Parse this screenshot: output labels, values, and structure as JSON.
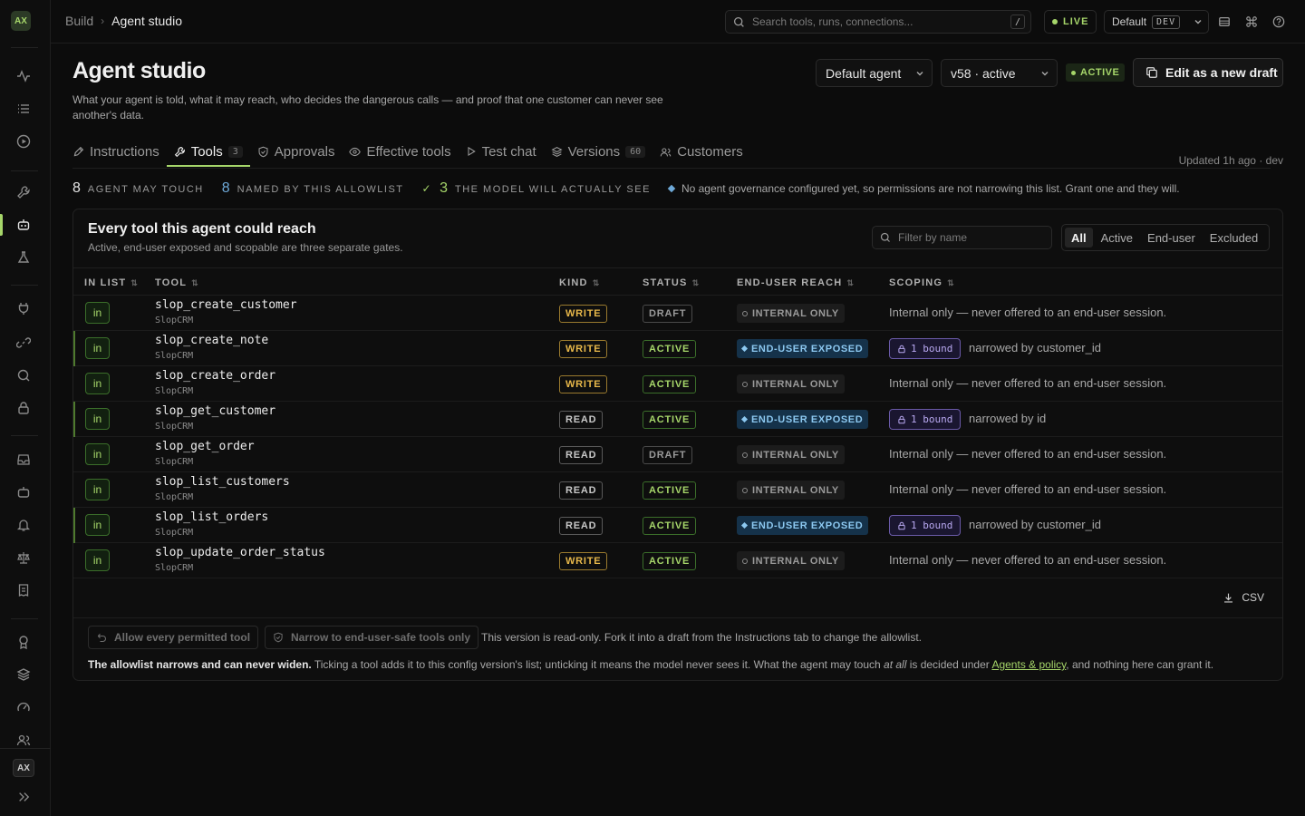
{
  "rail": {
    "logo": "AX",
    "avatar": "AX"
  },
  "topbar": {
    "breadcrumb": [
      "Build",
      "Agent studio"
    ],
    "search_placeholder": "Search tools, runs, connections...",
    "search_kbd": "/",
    "live_label": "LIVE",
    "env_label": "Default",
    "env_badge": "DEV"
  },
  "header": {
    "title": "Agent studio",
    "subtitle": "What your agent is told, what it may reach, who decides the dangerous calls — and proof that one customer can never see another's data.",
    "agent_select": "Default agent",
    "version_select": "v58 · active",
    "active_badge": "ACTIVE",
    "draft_button": "Edit as a new draft"
  },
  "tabs": [
    {
      "label": "Instructions",
      "count": ""
    },
    {
      "label": "Tools",
      "count": "3"
    },
    {
      "label": "Approvals",
      "count": ""
    },
    {
      "label": "Effective tools",
      "count": ""
    },
    {
      "label": "Test chat",
      "count": ""
    },
    {
      "label": "Versions",
      "count": "60"
    },
    {
      "label": "Customers",
      "count": ""
    }
  ],
  "updated": "Updated 1h ago · dev",
  "stats": {
    "may_touch_num": "8",
    "may_touch_label": "AGENT MAY TOUCH",
    "named_num": "8",
    "named_label": "NAMED BY THIS ALLOWLIST",
    "see_num": "3",
    "see_label": "THE MODEL WILL ACTUALLY SEE",
    "note": "No agent governance configured yet, so permissions are not narrowing this list. Grant one and they will."
  },
  "card": {
    "title": "Every tool this agent could reach",
    "subtitle": "Active, end-user exposed and scopable are three separate gates.",
    "filter_placeholder": "Filter by name",
    "segments": [
      "All",
      "Active",
      "End-user",
      "Excluded"
    ],
    "columns": [
      "IN LIST",
      "TOOL",
      "KIND",
      "STATUS",
      "END-USER REACH",
      "SCOPING"
    ],
    "csv_label": "CSV",
    "btn_allow_all": "Allow every permitted tool",
    "btn_narrow": "Narrow to end-user-safe tools only",
    "readonly_note": "This version is read-only. Fork it into a draft from the Instructions tab to change the allowlist.",
    "legal_bold": "The allowlist narrows and can never widen.",
    "legal_text1": " Ticking a tool adds it to this config version's list; unticking it means the model never sees it. What the agent may touch ",
    "legal_italic": "at all",
    "legal_text2": " is decided under ",
    "legal_link": "Agents & policy",
    "legal_text3": ", and nothing here can grant it."
  },
  "rows": [
    {
      "in": "in",
      "tool": "slop_create_customer",
      "system": "SlopCRM",
      "kind": "WRITE",
      "status": "DRAFT",
      "reach": "INTERNAL ONLY",
      "exposed": false,
      "scope": "Internal only — never offered to an end-user session.",
      "bound": "",
      "narrow": ""
    },
    {
      "in": "in",
      "tool": "slop_create_note",
      "system": "SlopCRM",
      "kind": "WRITE",
      "status": "ACTIVE",
      "reach": "END-USER EXPOSED",
      "exposed": true,
      "scope": "",
      "bound": "1 bound",
      "narrow": "narrowed by customer_id"
    },
    {
      "in": "in",
      "tool": "slop_create_order",
      "system": "SlopCRM",
      "kind": "WRITE",
      "status": "ACTIVE",
      "reach": "INTERNAL ONLY",
      "exposed": false,
      "scope": "Internal only — never offered to an end-user session.",
      "bound": "",
      "narrow": ""
    },
    {
      "in": "in",
      "tool": "slop_get_customer",
      "system": "SlopCRM",
      "kind": "READ",
      "status": "ACTIVE",
      "reach": "END-USER EXPOSED",
      "exposed": true,
      "scope": "",
      "bound": "1 bound",
      "narrow": "narrowed by id"
    },
    {
      "in": "in",
      "tool": "slop_get_order",
      "system": "SlopCRM",
      "kind": "READ",
      "status": "DRAFT",
      "reach": "INTERNAL ONLY",
      "exposed": false,
      "scope": "Internal only — never offered to an end-user session.",
      "bound": "",
      "narrow": ""
    },
    {
      "in": "in",
      "tool": "slop_list_customers",
      "system": "SlopCRM",
      "kind": "READ",
      "status": "ACTIVE",
      "reach": "INTERNAL ONLY",
      "exposed": false,
      "scope": "Internal only — never offered to an end-user session.",
      "bound": "",
      "narrow": ""
    },
    {
      "in": "in",
      "tool": "slop_list_orders",
      "system": "SlopCRM",
      "kind": "READ",
      "status": "ACTIVE",
      "reach": "END-USER EXPOSED",
      "exposed": true,
      "scope": "",
      "bound": "1 bound",
      "narrow": "narrowed by customer_id"
    },
    {
      "in": "in",
      "tool": "slop_update_order_status",
      "system": "SlopCRM",
      "kind": "WRITE",
      "status": "ACTIVE",
      "reach": "INTERNAL ONLY",
      "exposed": false,
      "scope": "Internal only — never offered to an end-user session.",
      "bound": "",
      "narrow": ""
    }
  ]
}
